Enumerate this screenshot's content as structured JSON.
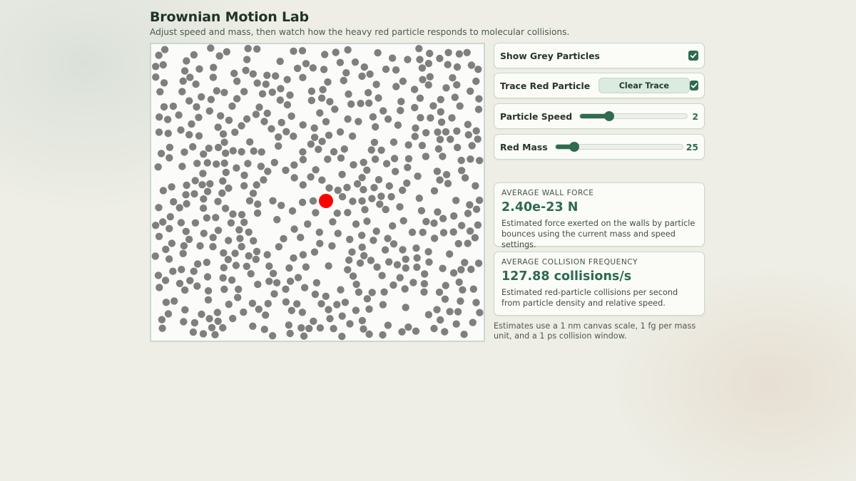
{
  "header": {
    "title": "Brownian Motion Lab",
    "subtitle": "Adjust speed and mass, then watch how the heavy red particle responds to molecular collisions."
  },
  "controls": {
    "show_grey": {
      "label": "Show Grey Particles",
      "checked": true
    },
    "trace_red": {
      "label": "Trace Red Particle",
      "button_label": "Clear Trace",
      "checked": true
    },
    "speed": {
      "label": "Particle Speed",
      "value": "2",
      "fraction": 0.27
    },
    "mass": {
      "label": "Red Mass",
      "value": "25",
      "fraction": 0.15
    }
  },
  "stats": {
    "wall_force": {
      "heading": "AVERAGE WALL FORCE",
      "value": "2.40e-23 N",
      "description": "Estimated force exerted on the walls by particle bounces using the current mass and speed settings."
    },
    "collision_frequency": {
      "heading": "AVERAGE COLLISION FREQUENCY",
      "value": "127.88 collisions/s",
      "description": "Estimated red-particle collisions per second from particle density and relative speed."
    }
  },
  "footnote": "Estimates use a 1 nm canvas scale, 1 fg per mass unit, and a 1 ps collision window.",
  "colors": {
    "accent": "#2e6b4f",
    "grey_particle": "#7f7f7f",
    "red_particle": "#ff0000"
  }
}
